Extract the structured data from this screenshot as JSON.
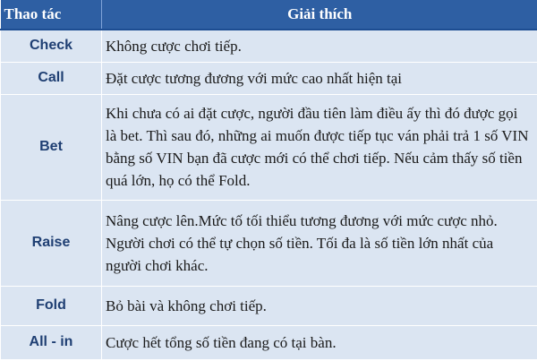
{
  "header": {
    "action": "Thao tác",
    "explanation": "Giải thích"
  },
  "rows": [
    {
      "action": "Check",
      "explanation": "Không cược chơi tiếp."
    },
    {
      "action": "Call",
      "explanation": "Đặt cược tương đương với mức cao nhất hiện tại"
    },
    {
      "action": "Bet",
      "explanation": "Khi chưa có ai đặt cược, người đầu tiên làm điều ấy thì đó được gọi là bet. Thì sau đó, những ai muốn được tiếp tục ván phải trả 1 số VIN bằng số VIN bạn đã cược mới có thể chơi tiếp. Nếu cảm thấy số tiền quá lớn, họ có thể Fold."
    },
    {
      "action": "Raise",
      "explanation": "Nâng cược lên.Mức tố tối thiểu tương đương với mức cược nhỏ. Người chơi có thể tự chọn số tiền. Tối đa là số tiền lớn nhất của người chơi khác."
    },
    {
      "action": "Fold",
      "explanation": "Bỏ bài và không chơi tiếp."
    },
    {
      "action": "All - in",
      "explanation": "Cược hết tổng số tiền đang có tại bàn."
    }
  ],
  "colors": {
    "header_bg": "#2e5fa3",
    "header_text": "#ffffff",
    "cell_bg": "#dbe5f2",
    "action_text": "#1f3f73"
  }
}
